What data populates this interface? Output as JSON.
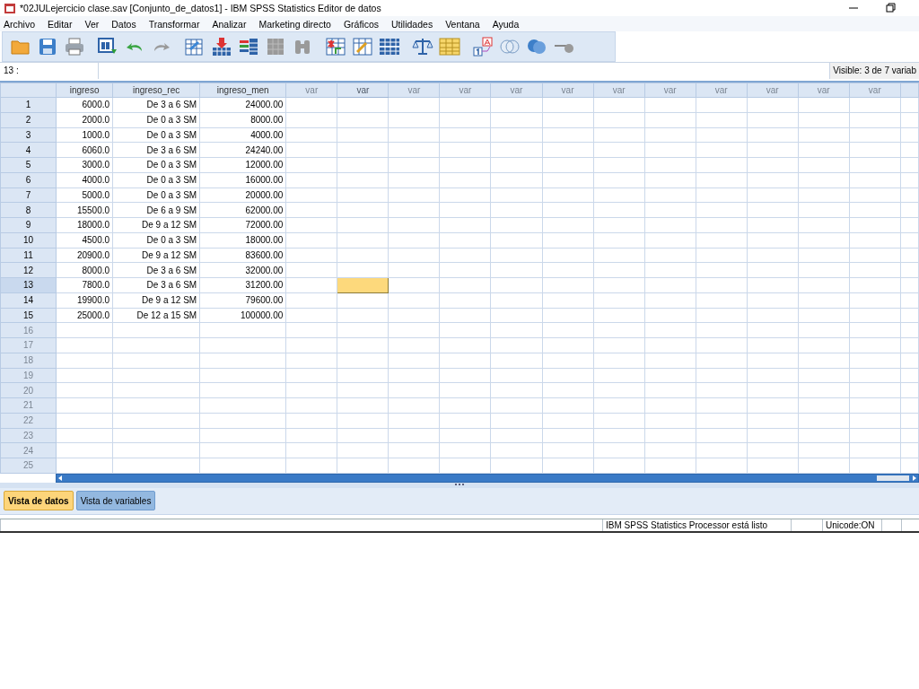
{
  "window": {
    "title": "*02JULejercicio clase.sav [Conjunto_de_datos1] - IBM SPSS Statistics Editor de datos"
  },
  "menu": [
    "Archivo",
    "Editar",
    "Ver",
    "Datos",
    "Transformar",
    "Analizar",
    "Marketing directo",
    "Gráficos",
    "Utilidades",
    "Ventana",
    "Ayuda"
  ],
  "toolbar": [
    {
      "kind": "open",
      "disabled": false
    },
    {
      "kind": "save",
      "disabled": false
    },
    {
      "kind": "print",
      "disabled": false
    },
    {
      "kind": "dialog",
      "disabled": false
    },
    {
      "kind": "undo",
      "disabled": false
    },
    {
      "kind": "redo",
      "disabled": true
    },
    {
      "kind": "goto-case",
      "disabled": false
    },
    {
      "kind": "goto-variable",
      "disabled": false
    },
    {
      "kind": "variables",
      "disabled": false
    },
    {
      "kind": "run",
      "disabled": true
    },
    {
      "kind": "find",
      "disabled": true
    },
    {
      "kind": "insert-cases",
      "disabled": false
    },
    {
      "kind": "insert-variable",
      "disabled": false
    },
    {
      "kind": "split",
      "disabled": false
    },
    {
      "kind": "weight",
      "disabled": false
    },
    {
      "kind": "select",
      "disabled": false
    },
    {
      "kind": "value-labels",
      "disabled": false
    },
    {
      "kind": "use-sets",
      "disabled": false
    },
    {
      "kind": "show-all",
      "disabled": false
    },
    {
      "kind": "spell",
      "disabled": true
    }
  ],
  "cell_editor": {
    "cell": "13 :",
    "visible": "Visible: 3 de 7 variab"
  },
  "grid": {
    "columns": [
      {
        "label": "ingreso",
        "kind": "data",
        "selected": false
      },
      {
        "label": "ingreso_rec",
        "kind": "data",
        "selected": false
      },
      {
        "label": "ingreso_men",
        "kind": "data",
        "selected": false
      },
      {
        "label": "var",
        "kind": "empty",
        "selected": false
      },
      {
        "label": "var",
        "kind": "empty",
        "selected": true
      },
      {
        "label": "var",
        "kind": "empty",
        "selected": false
      },
      {
        "label": "var",
        "kind": "empty",
        "selected": false
      },
      {
        "label": "var",
        "kind": "empty",
        "selected": false
      },
      {
        "label": "var",
        "kind": "empty",
        "selected": false
      },
      {
        "label": "var",
        "kind": "empty",
        "selected": false
      },
      {
        "label": "var",
        "kind": "empty",
        "selected": false
      },
      {
        "label": "var",
        "kind": "empty",
        "selected": false
      },
      {
        "label": "var",
        "kind": "empty",
        "selected": false
      },
      {
        "label": "var",
        "kind": "empty",
        "selected": false
      },
      {
        "label": "var",
        "kind": "empty",
        "selected": false
      }
    ],
    "rows": [
      {
        "number": "1",
        "cells": [
          "6000.0",
          "De 3 a 6 SM",
          "24000.00"
        ],
        "selected": false
      },
      {
        "number": "2",
        "cells": [
          "2000.0",
          "De 0 a 3 SM",
          "8000.00"
        ],
        "selected": false
      },
      {
        "number": "3",
        "cells": [
          "1000.0",
          "De 0 a 3 SM",
          "4000.00"
        ],
        "selected": false
      },
      {
        "number": "4",
        "cells": [
          "6060.0",
          "De 3 a 6 SM",
          "24240.00"
        ],
        "selected": false
      },
      {
        "number": "5",
        "cells": [
          "3000.0",
          "De 0 a 3 SM",
          "12000.00"
        ],
        "selected": false
      },
      {
        "number": "6",
        "cells": [
          "4000.0",
          "De 0 a 3 SM",
          "16000.00"
        ],
        "selected": false
      },
      {
        "number": "7",
        "cells": [
          "5000.0",
          "De 0 a 3 SM",
          "20000.00"
        ],
        "selected": false
      },
      {
        "number": "8",
        "cells": [
          "15500.0",
          "De 6 a 9 SM",
          "62000.00"
        ],
        "selected": false
      },
      {
        "number": "9",
        "cells": [
          "18000.0",
          "De 9 a 12 SM",
          "72000.00"
        ],
        "selected": false
      },
      {
        "number": "10",
        "cells": [
          "4500.0",
          "De 0 a 3 SM",
          "18000.00"
        ],
        "selected": false
      },
      {
        "number": "11",
        "cells": [
          "20900.0",
          "De 9 a 12 SM",
          "83600.00"
        ],
        "selected": false
      },
      {
        "number": "12",
        "cells": [
          "8000.0",
          "De 3 a 6 SM",
          "32000.00"
        ],
        "selected": false
      },
      {
        "number": "13",
        "cells": [
          "7800.0",
          "De 3 a 6 SM",
          "31200.00"
        ],
        "selected": true
      },
      {
        "number": "14",
        "cells": [
          "19900.0",
          "De 9 a 12 SM",
          "79600.00"
        ],
        "selected": false
      },
      {
        "number": "15",
        "cells": [
          "25000.0",
          "De 12 a 15 SM",
          "100000.00"
        ],
        "selected": false
      },
      {
        "number": "16",
        "cells": [],
        "selected": false
      },
      {
        "number": "17",
        "cells": [],
        "selected": false
      },
      {
        "number": "18",
        "cells": [],
        "selected": false
      },
      {
        "number": "19",
        "cells": [],
        "selected": false
      },
      {
        "number": "20",
        "cells": [],
        "selected": false
      },
      {
        "number": "21",
        "cells": [],
        "selected": false
      },
      {
        "number": "22",
        "cells": [],
        "selected": false
      },
      {
        "number": "23",
        "cells": [],
        "selected": false
      },
      {
        "number": "24",
        "cells": [],
        "selected": false
      },
      {
        "number": "25",
        "cells": [],
        "selected": false
      }
    ]
  },
  "tabs": [
    {
      "label": "Vista de datos",
      "selected": true
    },
    {
      "label": "Vista de variables",
      "selected": false
    }
  ],
  "status_bar": {
    "processor": "IBM SPSS Statistics Processor está listo",
    "encoding": "Unicode:ON"
  }
}
